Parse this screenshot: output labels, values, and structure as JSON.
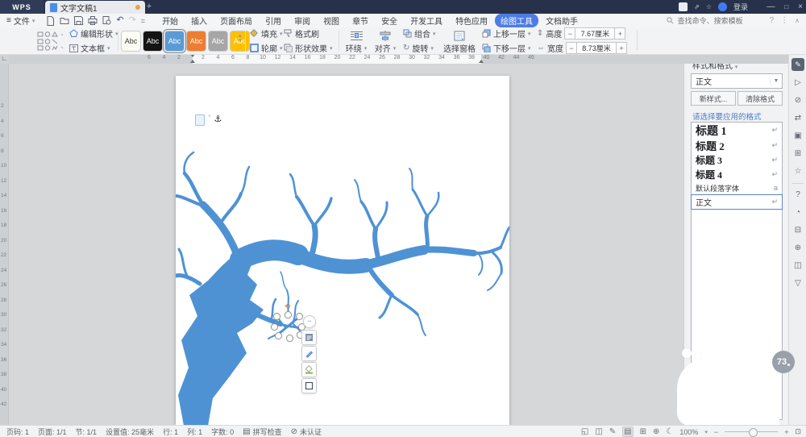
{
  "titlebar": {
    "logo_text": "WPS",
    "tab_title": "文字文稿1",
    "new_tab": "+",
    "user_label": "登录"
  },
  "menubar": {
    "file_label": "文件",
    "menus": [
      "开始",
      "插入",
      "页面布局",
      "引用",
      "审阅",
      "视图",
      "章节",
      "安全",
      "开发工具",
      "特色应用",
      "绘图工具",
      "文档助手"
    ],
    "active_menu": "绘图工具",
    "search_placeholder": "查找命令、搜索模板",
    "help": "?",
    "quick_icons": [
      "new-doc-icon",
      "open-icon",
      "save-icon",
      "print-icon",
      "preview-icon",
      "undo-icon",
      "redo-icon",
      "more-icon"
    ]
  },
  "ribbon": {
    "edit_shape": "编辑形状",
    "text_box": "文本框",
    "style_gallery": [
      {
        "label": "Abc",
        "bg": "#fdfdf3",
        "fg": "#333333"
      },
      {
        "label": "Abc",
        "bg": "#141414",
        "fg": "#ffffff"
      },
      {
        "label": "Abc",
        "bg": "#5b9bd5",
        "fg": "#ffffff",
        "selected": true
      },
      {
        "label": "Abc",
        "bg": "#ed7d31",
        "fg": "#ffffff"
      },
      {
        "label": "Abc",
        "bg": "#a6a6a6",
        "fg": "#ffffff"
      },
      {
        "label": "Abc",
        "bg": "#ffc000",
        "fg": "#ffffff"
      }
    ],
    "fill": "填充",
    "format_painter": "格式刷",
    "outline": "轮廓",
    "shape_effects": "形状效果",
    "wrap": "环绕",
    "align": "对齐",
    "group": "组合",
    "rotate": "旋转",
    "selection_pane": "选择窗格",
    "bring_forward": "上移一层",
    "send_backward": "下移一层",
    "height_label": "高度",
    "height_value": "7.67厘米",
    "width_label": "宽度",
    "width_value": "8.73厘米",
    "stepper_minus": "−",
    "stepper_plus": "+"
  },
  "ruler": {
    "h_margin_numbers": [
      "6",
      "4",
      "2"
    ],
    "h_numbers": [
      "2",
      "4",
      "6",
      "8",
      "10",
      "12",
      "14",
      "16",
      "18",
      "20",
      "22",
      "24",
      "26",
      "28",
      "30",
      "32",
      "34",
      "36",
      "38",
      "40",
      "42",
      "44",
      "46"
    ],
    "v_numbers": [
      "2",
      "4",
      "6",
      "8",
      "10",
      "12",
      "14",
      "16",
      "18",
      "20",
      "22",
      "24",
      "26",
      "28",
      "30",
      "32",
      "34",
      "36",
      "38",
      "40",
      "42"
    ]
  },
  "canvas": {
    "tree_color": "#4e92d4",
    "anchor_symbol": "⚓",
    "collapse_glyph": "−",
    "float_toolbar_icons": [
      "layout-options-icon",
      "outline-pen-icon",
      "fill-bucket-icon",
      "shape-icon"
    ]
  },
  "styles_panel": {
    "title": "样式和格式",
    "current_style": "正文",
    "new_style_button": "新样式...",
    "clear_format_button": "清除格式",
    "hint": "请选择要应用的格式",
    "styles": [
      {
        "name": "标题 1",
        "mark": "↵"
      },
      {
        "name": "标题 2",
        "mark": "↵"
      },
      {
        "name": "标题 3",
        "mark": "↵"
      },
      {
        "name": "标题 4",
        "mark": "↵"
      },
      {
        "name": "默认段落字体",
        "mark": "a"
      },
      {
        "name": "正文",
        "mark": "↵",
        "selected": true
      }
    ],
    "rail_icons": [
      "styles-brush-icon",
      "select-icon",
      "shape-icon",
      "adjust-icon",
      "lock-icon",
      "layers-icon",
      "star-icon",
      "help-icon",
      "history-icon",
      "table-icon",
      "share-icon",
      "image-icon",
      "more-down-icon"
    ]
  },
  "assistant": {
    "badge": "73"
  },
  "statusbar": {
    "items": [
      "页码: 1",
      "页面: 1/1",
      "节: 1/1",
      "设置值: 25毫米",
      "行: 1",
      "列: 1",
      "字数: 0"
    ],
    "spell_check": "拼写检查",
    "certify": "未认证",
    "zoom_value": "100%",
    "view_icons": [
      "fullscreen-icon",
      "two-page-icon",
      "ink-icon",
      "print-layout-icon",
      "web-layout-icon",
      "outline-icon",
      "eye-protect-icon"
    ]
  }
}
